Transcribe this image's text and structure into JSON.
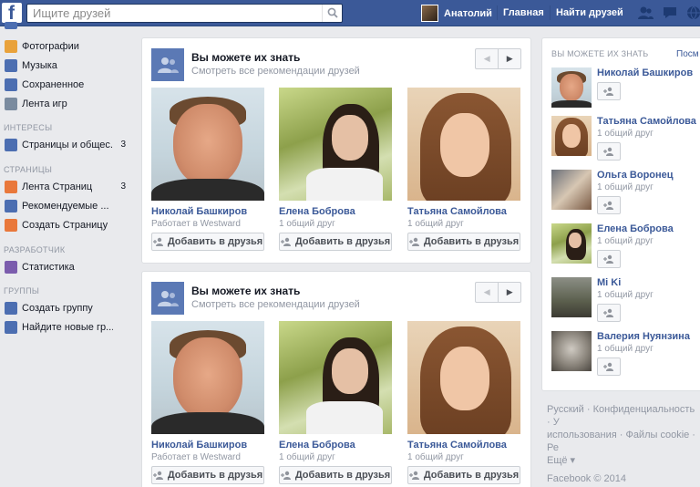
{
  "topbar": {
    "logo": "f",
    "search_placeholder": "Ищите друзей",
    "user_name": "Анатолий",
    "home_label": "Главная",
    "find_friends_label": "Найти друзей",
    "icons": [
      "friend-requests-icon",
      "messages-icon",
      "notifications-icon"
    ]
  },
  "leftnav": {
    "items": [
      {
        "label": "Фотографии",
        "icon": "photos-icon",
        "color": "#e9a23b"
      },
      {
        "label": "Музыка",
        "icon": "music-icon",
        "color": "#4c6eb1"
      },
      {
        "label": "Сохраненное",
        "icon": "saved-icon",
        "color": "#4c6eb1"
      },
      {
        "label": "Лента игр",
        "icon": "games-icon",
        "color": "#7a8b9f"
      }
    ],
    "sections": [
      {
        "heading": "ИНТЕРЕСЫ",
        "items": [
          {
            "label": "Страницы и общес...",
            "count": "3",
            "icon": "rss-icon",
            "color": "#4c6eb1"
          }
        ]
      },
      {
        "heading": "СТРАНИЦЫ",
        "items": [
          {
            "label": "Лента Страниц",
            "count": "3",
            "icon": "pages-feed-icon",
            "color": "#e9783b"
          },
          {
            "label": "Рекомендуемые ...",
            "count": "",
            "icon": "like-icon",
            "color": "#4c6eb1"
          },
          {
            "label": "Создать Страницу",
            "count": "",
            "icon": "create-page-icon",
            "color": "#e9783b"
          }
        ]
      },
      {
        "heading": "РАЗРАБОТЧИК",
        "items": [
          {
            "label": "Статистика",
            "count": "",
            "icon": "stats-icon",
            "color": "#7b5cad"
          }
        ]
      },
      {
        "heading": "ГРУППЫ",
        "items": [
          {
            "label": "Создать группу",
            "count": "",
            "icon": "create-group-icon",
            "color": "#4c6eb1"
          },
          {
            "label": "Найдите новые гр...",
            "count": "",
            "icon": "find-groups-icon",
            "color": "#4c6eb1"
          }
        ]
      }
    ]
  },
  "pymk_cards": [
    {
      "title": "Вы можете их знать",
      "subtitle": "Смотреть все рекомендации друзей",
      "people": [
        {
          "name": "Николай Башкиров",
          "sub": "Работает в Westward",
          "button": "Добавить в друзья"
        },
        {
          "name": "Елена Боброва",
          "sub": "1 общий друг",
          "button": "Добавить в друзья"
        },
        {
          "name": "Татьяна Самойлова",
          "sub": "1 общий друг",
          "button": "Добавить в друзья"
        }
      ]
    },
    {
      "title": "Вы можете их знать",
      "subtitle": "Смотреть все рекомендации друзей",
      "people": [
        {
          "name": "Николай Башкиров",
          "sub": "Работает в Westward",
          "button": "Добавить в друзья"
        },
        {
          "name": "Елена Боброва",
          "sub": "1 общий друг",
          "button": "Добавить в друзья"
        },
        {
          "name": "Татьяна Самойлова",
          "sub": "1 общий друг",
          "button": "Добавить в друзья"
        }
      ]
    }
  ],
  "right_pymk": {
    "title": "ВЫ МОЖЕТЕ ИХ ЗНАТЬ",
    "more": "Посм",
    "people": [
      {
        "name": "Николай Башкиров",
        "sub": ""
      },
      {
        "name": "Татьяна Самойлова",
        "sub": "1 общий друг"
      },
      {
        "name": "Ольга Воронец",
        "sub": "1 общий друг"
      },
      {
        "name": "Елена Боброва",
        "sub": "1 общий друг"
      },
      {
        "name": "Mi Ki",
        "sub": "1 общий друг"
      },
      {
        "name": "Валерия Нуянзина",
        "sub": "1 общий друг"
      }
    ]
  },
  "footer": {
    "line1": "Русский · Конфиденциальность · У",
    "line2": "использования · Файлы cookie · Ре",
    "line3": "Ещё ▾",
    "copyright": "Facebook © 2014"
  }
}
